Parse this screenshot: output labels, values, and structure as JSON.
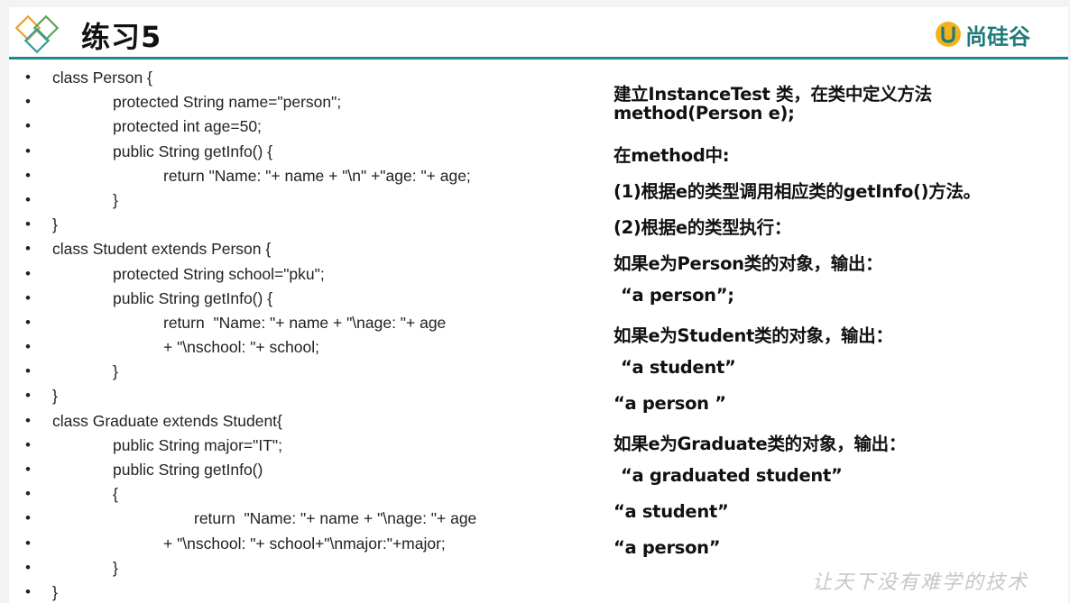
{
  "header": {
    "title": "练习5",
    "logo_text": "尚硅谷"
  },
  "code_lines": [
    {
      "indent": 0,
      "text": "class Person {"
    },
    {
      "indent": 1,
      "text": "protected String name=\"person\";"
    },
    {
      "indent": 1,
      "text": "protected int age=50;"
    },
    {
      "indent": 1,
      "text": "public String getInfo() {"
    },
    {
      "indent": 2,
      "text": "return \"Name: \"+ name + \"\\n\" +\"age: \"+ age;"
    },
    {
      "indent": 1,
      "text": "}",
      "extra": "close1"
    },
    {
      "indent": 0,
      "text": "}"
    },
    {
      "indent": 0,
      "text": "class Student extends Person {"
    },
    {
      "indent": 1,
      "text": "protected String school=\"pku\";"
    },
    {
      "indent": 1,
      "text": "public String getInfo() {"
    },
    {
      "indent": 2,
      "text": "return  \"Name: \"+ name + \"\\nage: \"+ age"
    },
    {
      "indent": 2,
      "text": "+ \"\\nschool: \"+ school;"
    },
    {
      "indent": 1,
      "text": "}"
    },
    {
      "indent": 0,
      "text": "}"
    },
    {
      "indent": 0,
      "text": "class Graduate extends Student{"
    },
    {
      "indent": 1,
      "text": "public String major=\"IT\";"
    },
    {
      "indent": 1,
      "text": "public String getInfo()"
    },
    {
      "indent": 1,
      "text": "{"
    },
    {
      "indent": 3,
      "text": "return  \"Name: \"+ name + \"\\nage: \"+ age"
    },
    {
      "indent": 2,
      "text": "+ \"\\nschool: \"+ school+\"\\nmajor:\"+major;"
    },
    {
      "indent": 1,
      "text": "}"
    },
    {
      "indent": 0,
      "text": "}"
    }
  ],
  "bullet_char": "•",
  "right_panel": [
    "建立InstanceTest 类，在类中定义方法",
    "method(Person e);",
    "在method中:",
    "(1)根据e的类型调用相应类的getInfo()方法。",
    "(2)根据e的类型执行：",
    "如果e为Person类的对象，输出：",
    "“a person”;",
    "如果e为Student类的对象，输出：",
    "“a student”",
    "“a person ”",
    "如果e为Graduate类的对象，输出：",
    "“a graduated student”",
    "“a student”",
    "“a person”"
  ],
  "watermark": "让天下没有难学的技术",
  "colors": {
    "accent": "#1f8a8a",
    "logo": "#1f7a7a",
    "diamond_green": "#5aa55a",
    "diamond_orange": "#e8a030"
  }
}
